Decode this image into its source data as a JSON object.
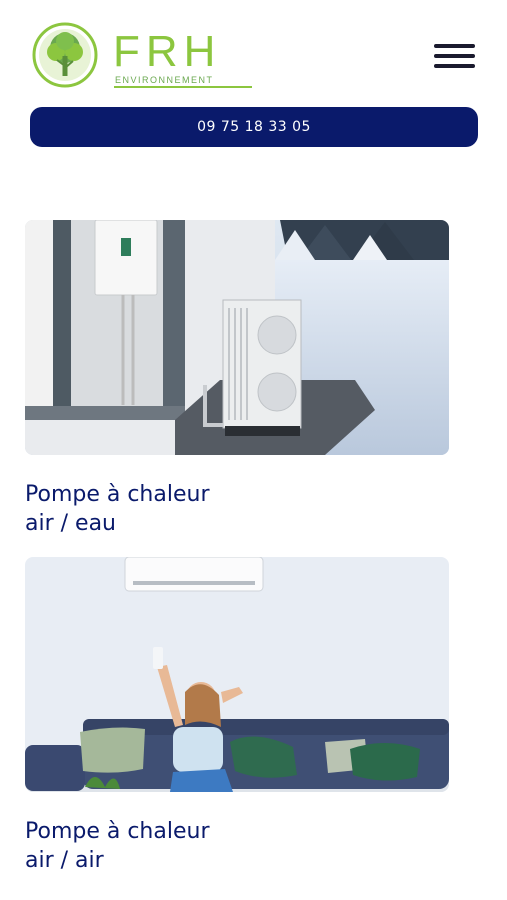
{
  "header": {
    "logo": {
      "brand": "FRH",
      "tagline": "ENVIRONNEMENT"
    },
    "menu_icon": "hamburger-icon",
    "phone_label": "09 75 18 33 05"
  },
  "colors": {
    "primary_navy": "#0a1a6b",
    "logo_green": "#8cc63f"
  },
  "services": [
    {
      "title_line1": "Pompe à chaleur",
      "title_line2": "air / eau"
    },
    {
      "title_line1": "Pompe à chaleur",
      "title_line2": "air / air"
    }
  ]
}
